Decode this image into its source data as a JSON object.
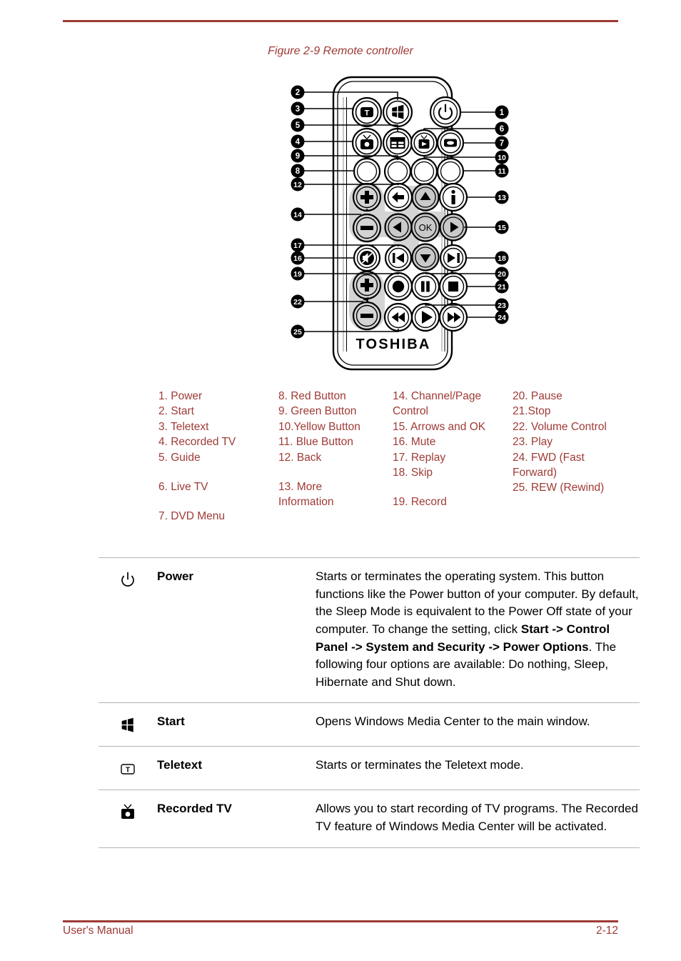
{
  "figure": {
    "caption": "Figure 2-9 Remote controller",
    "brand": "TOSHIBA",
    "ok_label": "OK",
    "callouts": [
      1,
      2,
      3,
      4,
      5,
      6,
      7,
      8,
      9,
      10,
      11,
      12,
      13,
      14,
      15,
      16,
      17,
      18,
      19,
      20,
      21,
      22,
      23,
      24,
      25
    ]
  },
  "legend": {
    "columns": [
      [
        "1. Power",
        "2. Start",
        "3. Teletext",
        "4. Recorded TV",
        "5. Guide",
        "",
        "6. Live TV",
        "",
        "7. DVD Menu"
      ],
      [
        "8. Red Button",
        "9. Green Button",
        "10.Yellow Button",
        "11. Blue Button",
        "12. Back",
        "",
        "13. More\nInformation"
      ],
      [
        "14. Channel/Page\nControl",
        "15. Arrows and OK",
        "16. Mute",
        "17. Replay",
        "18. Skip",
        "",
        "19. Record"
      ],
      [
        "20. Pause",
        "21.Stop",
        "22. Volume Control",
        "23. Play",
        "24. FWD (Fast\nForward)",
        "25. REW (Rewind)"
      ]
    ]
  },
  "descriptions": [
    {
      "icon": "power-icon",
      "name": "Power",
      "text_parts": [
        {
          "t": "Starts or terminates the operating system. This button functions like the Power button of your computer. By default, the Sleep Mode is equivalent to the Power Off state of your computer. To change the setting, click ",
          "b": false
        },
        {
          "t": "Start -> Control Panel -> System and Security -> Power Options",
          "b": true
        },
        {
          "t": ". The following four options are available: Do nothing, Sleep, Hibernate and Shut down.",
          "b": false
        }
      ]
    },
    {
      "icon": "windows-start-icon",
      "name": "Start",
      "text_parts": [
        {
          "t": "Opens Windows Media Center to the main window.",
          "b": false
        }
      ]
    },
    {
      "icon": "teletext-icon",
      "name": "Teletext",
      "text_parts": [
        {
          "t": "Starts or terminates the Teletext mode.",
          "b": false
        }
      ]
    },
    {
      "icon": "recorded-tv-icon",
      "name": "Recorded TV",
      "text_parts": [
        {
          "t": "Allows you to start recording of TV programs. The Recorded TV feature of Windows Media Center will be activated.",
          "b": false
        }
      ]
    }
  ],
  "footer": {
    "left": "User's Manual",
    "right": "2-12"
  },
  "colors": {
    "accent": "#9e3a36",
    "rule": "#b4b4b4",
    "button_pad": "#d4d4d4"
  }
}
